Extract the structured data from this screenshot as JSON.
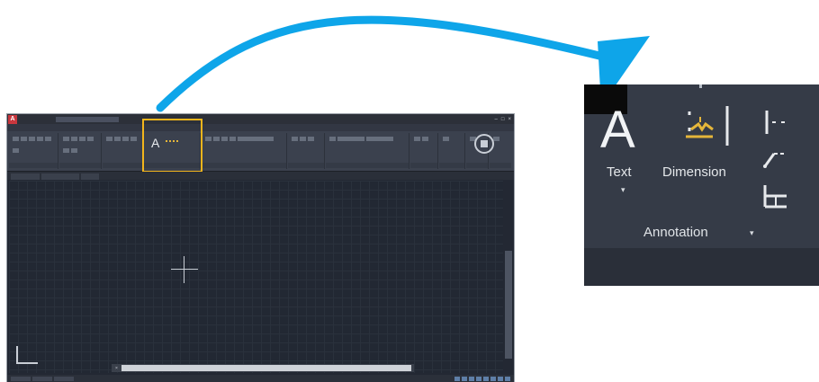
{
  "arrow": {
    "color": "#0ea5e9"
  },
  "colors": {
    "highlight": "#f2b51c",
    "app_red": "#c8373e",
    "ribbon_bg": "#3b414e",
    "canvas_bg": "#222833",
    "dimension_icon": "#e5b63a"
  },
  "small_window": {
    "app_logo": "A",
    "highlighted_panel": "Annotation"
  },
  "zoomed_panel": {
    "text_icon_glyph": "A",
    "text_label": "Text",
    "dimension_label": "Dimension",
    "group_label": "Annotation",
    "dropdown_glyph": "▾",
    "group_dropdown_glyph": "▾",
    "icons": [
      "text-icon",
      "dimension-icon",
      "leader-icon",
      "multileader-icon",
      "table-icon"
    ]
  }
}
